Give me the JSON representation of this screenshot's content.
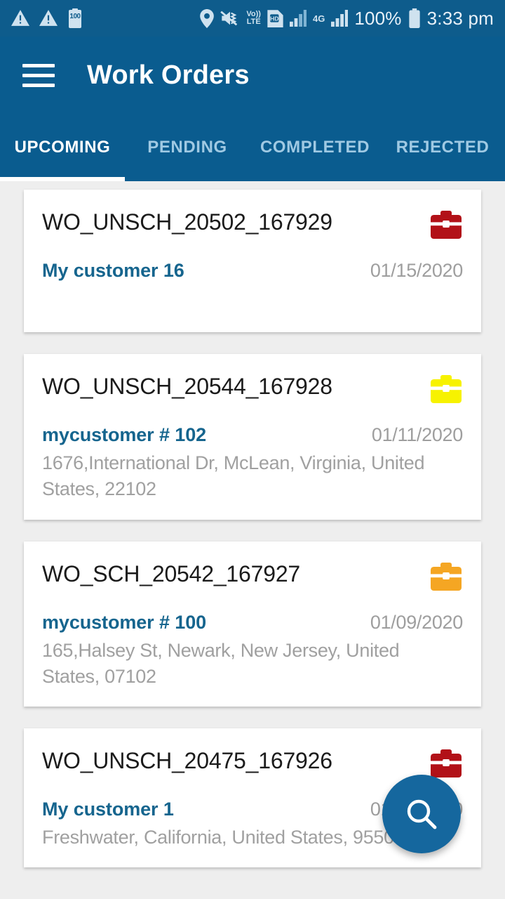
{
  "status_bar": {
    "left_icons": [
      "warning-triangle-icon",
      "warning-triangle-icon",
      "battery-saver-icon"
    ],
    "battery_saver_level": "100",
    "right_icons": [
      "location-pin-icon",
      "mute-vibrate-icon",
      "volte-icon",
      "sim-hd-icon",
      "signal-bars-icon",
      "network-4g-icon",
      "signal-bars-2-icon",
      "battery-icon"
    ],
    "volte_line1": "Vo))",
    "volte_line2": "LTE",
    "sim_label": "HD",
    "network_label": "4G",
    "battery_percent": "100%",
    "time": "3:33 pm"
  },
  "app_bar": {
    "menu_icon": "hamburger-menu-icon",
    "title": "Work Orders"
  },
  "tabs": {
    "active_index": 0,
    "items": [
      {
        "label": "UPCOMING"
      },
      {
        "label": "PENDING"
      },
      {
        "label": "COMPLETED"
      },
      {
        "label": "REJECTED"
      }
    ]
  },
  "colors": {
    "app_bar_blue": "#0A5C8F",
    "status_bar_blue": "#0E5C8C",
    "tab_active": "#FFFFFF",
    "tab_inactive": "#9FC9E3",
    "customer_blue": "#16658E",
    "date_gray": "#9E9E9E",
    "address_gray": "#A0A0A0",
    "fab_blue": "#15679E",
    "icon_red": "#B21118",
    "icon_yellow": "#F7F200",
    "icon_orange": "#F5A623",
    "page_background": "#EEEEEE"
  },
  "work_orders": [
    {
      "id": "WO_UNSCH_20502_167929",
      "status_icon": "briefcase-icon",
      "status_color": "#B21118",
      "customer": "My customer 16",
      "date": "01/15/2020",
      "address": ""
    },
    {
      "id": "WO_UNSCH_20544_167928",
      "status_icon": "briefcase-icon",
      "status_color": "#F7F200",
      "customer": "mycustomer # 102",
      "date": "01/11/2020",
      "address": "1676,International Dr, McLean, Virginia, United States, 22102"
    },
    {
      "id": "WO_SCH_20542_167927",
      "status_icon": "briefcase-icon",
      "status_color": "#F5A623",
      "customer": "mycustomer # 100",
      "date": "01/09/2020",
      "address": "165,Halsey St, Newark, New Jersey, United States, 07102"
    },
    {
      "id": "WO_UNSCH_20475_167926",
      "status_icon": "briefcase-icon",
      "status_color": "#B21118",
      "customer": "My customer 1",
      "date": "01/08/2020",
      "address": "Freshwater, California, United States, 95503"
    }
  ],
  "fab": {
    "icon": "search-icon",
    "label": "Search"
  }
}
